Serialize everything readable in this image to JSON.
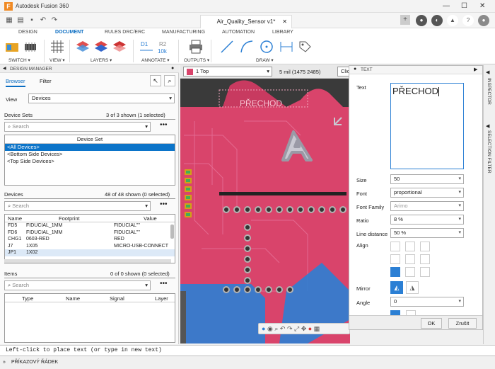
{
  "window": {
    "title": "Autodesk Fusion 360",
    "doc_tab": "Air_Quality_Sensor v1*"
  },
  "ribbon": {
    "tabs": [
      "DESIGN",
      "DOCUMENT",
      "RULES DRC/ERC",
      "MANUFACTURING",
      "AUTOMATION",
      "LIBRARY"
    ],
    "groups": [
      "SWITCH ▾",
      "VIEW ▾",
      "LAYERS ▾",
      "ANNOTATE ▾",
      "OUTPUTS ▾",
      "DRAW ▾"
    ]
  },
  "panel": {
    "title": "DESIGN MANAGER",
    "tabs": {
      "browser": "Browser",
      "filter": "Filter"
    },
    "view_label": "View",
    "view_value": "Devices",
    "device_sets": {
      "label": "Device Sets",
      "count": "3 of 3 shown (1 selected)",
      "search": "Search",
      "header": "Device Set",
      "rows": [
        "<All Devices>",
        "<Bottom Side Devices>",
        "<Top Side Devices>"
      ]
    },
    "devices": {
      "label": "Devices",
      "count": "48 of 48 shown (0 selected)",
      "search": "Search",
      "headers": [
        "Name",
        "Footprint",
        "Value"
      ],
      "rows": [
        [
          "FD5",
          "FIDUCIAL_1MM",
          "FIDUCIAL\"\""
        ],
        [
          "FD6",
          "FIDUCIAL_1MM",
          "FIDUCIAL\"\""
        ],
        [
          "CHG1",
          "0603-RED",
          "RED"
        ],
        [
          "J7",
          "1X05",
          "MICRO-USB-CONNECT"
        ],
        [
          "JP1",
          "1X02",
          ""
        ]
      ]
    },
    "items": {
      "label": "Items",
      "count": "0 of 0 shown (0 selected)",
      "search": "Search",
      "headers": [
        "Type",
        "Name",
        "Signal",
        "Layer"
      ]
    }
  },
  "canvas": {
    "layer": "1 Top",
    "grid": "5 mil (1475 2485)",
    "click_hint": "Click",
    "board_text": "PŘECHOD"
  },
  "text_panel": {
    "title": "TEXT",
    "text_label": "Text",
    "text_value": "PŘECHOD",
    "size_label": "Size",
    "size_value": "50",
    "font_label": "Font",
    "font_value": "proportional",
    "font_family_label": "Font Family",
    "font_family_value": "Arimo",
    "ratio_label": "Ratio",
    "ratio_value": "8 %",
    "line_distance_label": "Line distance",
    "line_distance_value": "50 %",
    "align_label": "Align",
    "mirror_label": "Mirror",
    "angle_label": "Angle",
    "angle_value": "0",
    "ok": "OK",
    "cancel": "Zrušit"
  },
  "right_strip": {
    "inspector": "INSPECTOR",
    "selection_filter": "SELECTION FILTER"
  },
  "status": "Left-click to place text (or type in new text)",
  "command_bar": "PŘÍKAZOVÝ ŘÁDEK",
  "colors": {
    "accent": "#0a6dc2",
    "board": "#d9446b",
    "copper_bottom": "#2b7fd4"
  }
}
